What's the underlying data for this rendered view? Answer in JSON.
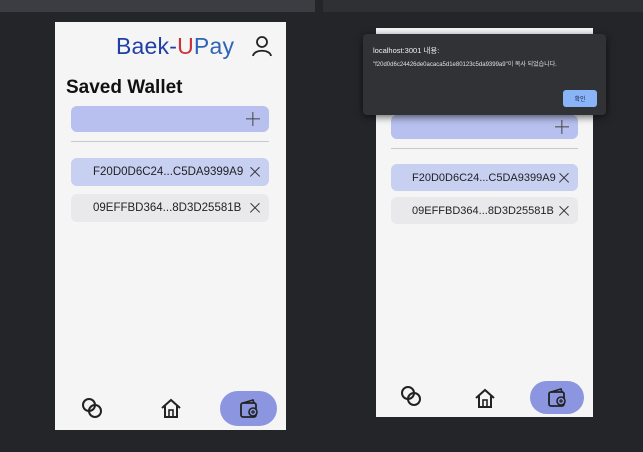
{
  "left": {
    "brand": {
      "part1": "B",
      "part2": "aek-",
      "part3": "U",
      "part4": "Pay"
    },
    "title": "Saved Wallet",
    "wallets": [
      {
        "label": "F20D0D6C24...C5DA9399A9",
        "selected": true
      },
      {
        "label": "09EFFBD364...8D3D25581B",
        "selected": false
      }
    ]
  },
  "right": {
    "wallets": [
      {
        "label": "F20D0D6C24...C5DA9399A9",
        "selected": true
      },
      {
        "label": "09EFFBD364...8D3D25581B",
        "selected": false
      }
    ],
    "dialog": {
      "title": "localhost:3001 내용:",
      "message": "\"f20d0d6c24426de0acaca5d1e80123c5da9399a9\"이 복사 되었습니다.",
      "ok_label": "확인"
    }
  },
  "icons": {
    "account": "person-outline-icon",
    "add": "plus-icon",
    "remove": "close-icon",
    "nav": [
      "link-chain-icon",
      "home-icon",
      "wallet-icon"
    ]
  },
  "colors": {
    "accent": "#b7c0ee",
    "selected_wallet": "#c8d0f2",
    "nav_pill": "#8c95df",
    "dialog_bg": "#303236",
    "dialog_button": "#8ab4f8"
  }
}
